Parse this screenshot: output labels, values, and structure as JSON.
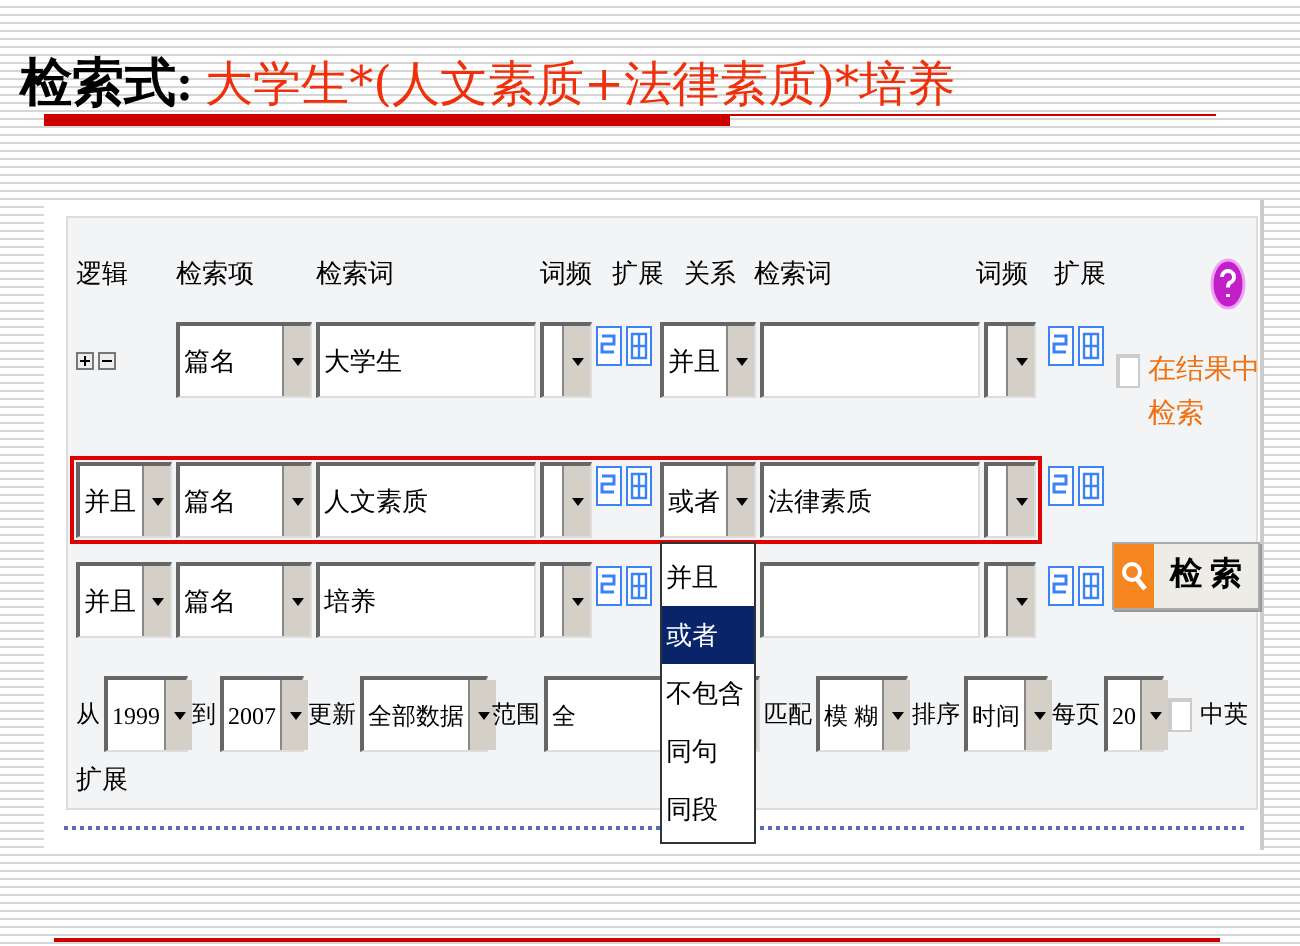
{
  "title": {
    "label": "检索式:",
    "expression": "大学生*(人文素质+法律素质)*培养"
  },
  "headers": [
    "逻辑",
    "检索项",
    "检索词",
    "词频",
    "扩展",
    "关系",
    "检索词",
    "词频",
    "扩展"
  ],
  "rows": [
    {
      "kind": "first",
      "highlighted": false,
      "field": "篇名",
      "term": "大学生",
      "relation": {
        "value": "并且"
      },
      "term2": ""
    },
    {
      "kind": "logic",
      "highlighted": true,
      "logic": "并且",
      "field": "篇名",
      "term": "人文素质",
      "relation": {
        "value": "或者",
        "expanded": true,
        "options": [
          {
            "label": "并且",
            "selected": false
          },
          {
            "label": "或者",
            "selected": true
          },
          {
            "label": "不包含",
            "selected": false
          },
          {
            "label": "同句",
            "selected": false
          },
          {
            "label": "同段",
            "selected": false
          }
        ]
      },
      "term2": "法律素质"
    },
    {
      "kind": "logic",
      "highlighted": false,
      "logic": "并且",
      "field": "篇名",
      "term": "培养",
      "term2": ""
    }
  ],
  "search_in_results": {
    "checked": false,
    "label": "在结果中检索"
  },
  "search_button": {
    "label": "检 索"
  },
  "filters": [
    {
      "label": "从",
      "value": "1999"
    },
    {
      "label": "到",
      "value": "2007"
    },
    {
      "label": "更新",
      "value": "全部数据"
    },
    {
      "label": "范围",
      "value": "全"
    },
    {
      "label": "匹配",
      "value": "模 糊"
    },
    {
      "label": "排序",
      "value": "时间"
    },
    {
      "label": "每页",
      "value": "20"
    }
  ],
  "language": {
    "checked": false,
    "label": "中英"
  },
  "expand_label": "扩展"
}
